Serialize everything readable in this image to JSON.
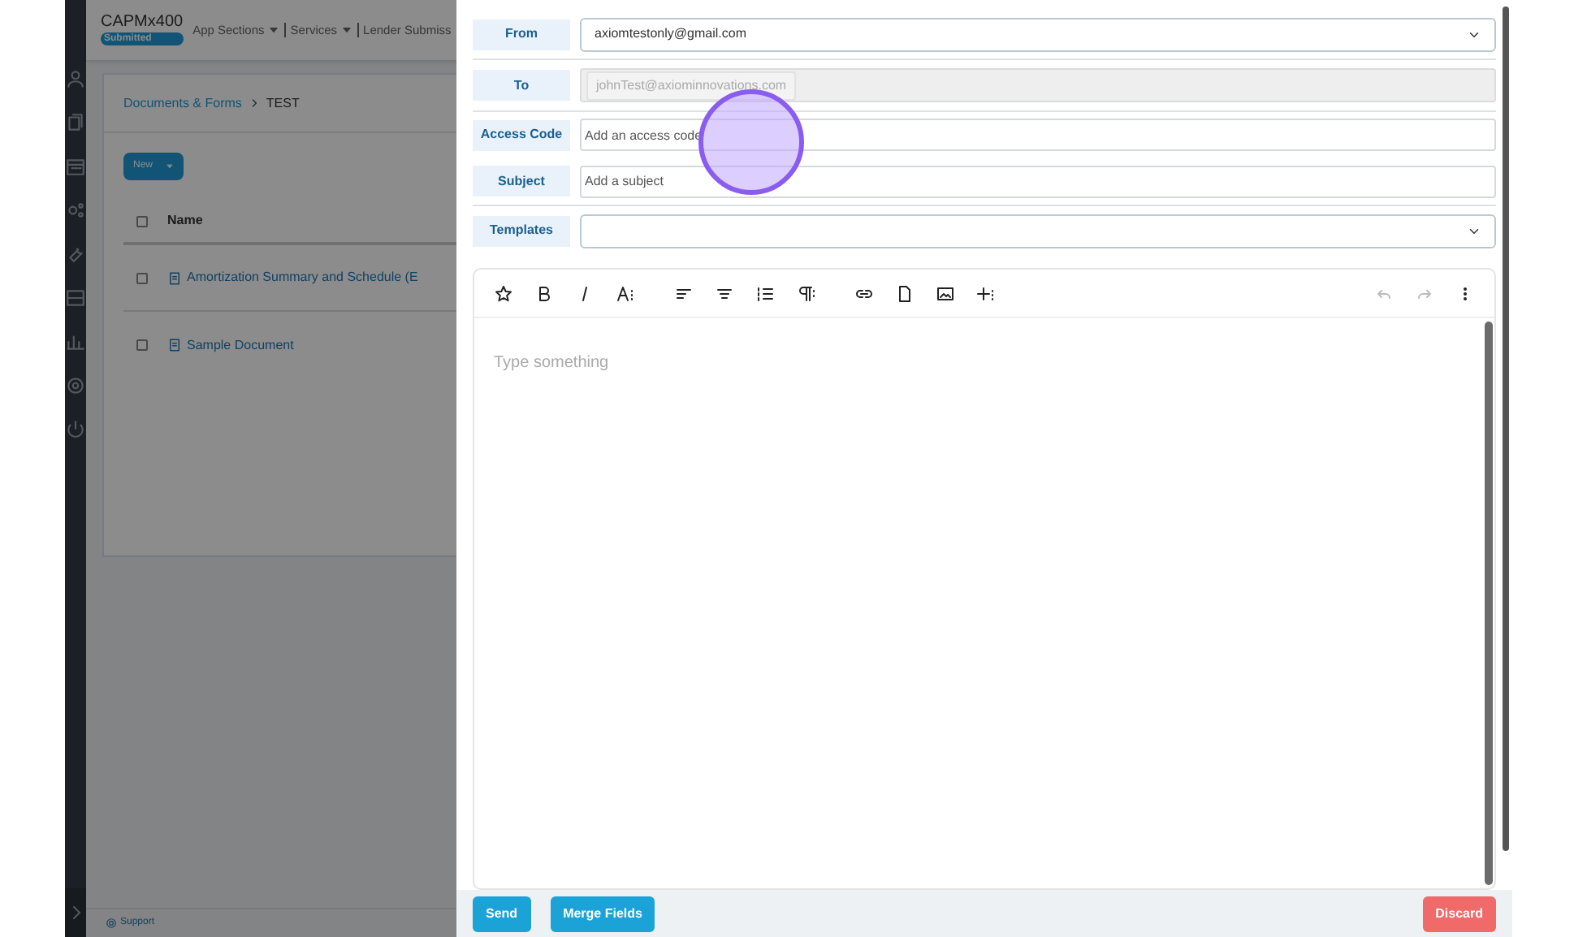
{
  "app": {
    "brand": "CAPMx400",
    "status_badge": "Submitted",
    "nav": [
      "App Sections",
      "Services",
      "Lender Submiss"
    ],
    "breadcrumb": {
      "parent": "Documents & Forms",
      "current": "TEST"
    },
    "new_button": "New",
    "table": {
      "columns": [
        "Name"
      ],
      "header_checked": false,
      "rows": [
        {
          "name": "Amortization Summary and Schedule (E",
          "checked": false
        },
        {
          "name": "Sample Document",
          "checked": false
        }
      ]
    },
    "footer_link": "Support"
  },
  "email": {
    "fields": [
      {
        "label": "From",
        "kind": "select",
        "value": "axiomtestonly@gmail.com"
      },
      {
        "label": "To",
        "kind": "chips",
        "chips": [
          "johnTest@axiominnovations.com"
        ]
      },
      {
        "label": "Access Code",
        "kind": "input",
        "placeholder": "Add an access code"
      },
      {
        "label": "Subject",
        "kind": "input",
        "placeholder": "Add a subject"
      },
      {
        "label": "Templates",
        "kind": "select"
      }
    ],
    "editor": {
      "placeholder": "Type something"
    },
    "buttons": [
      {
        "label": "Send",
        "kind": "primary"
      },
      {
        "label": "Merge Fields",
        "kind": "primary"
      },
      {
        "label": "Discard",
        "kind": "danger"
      }
    ]
  }
}
